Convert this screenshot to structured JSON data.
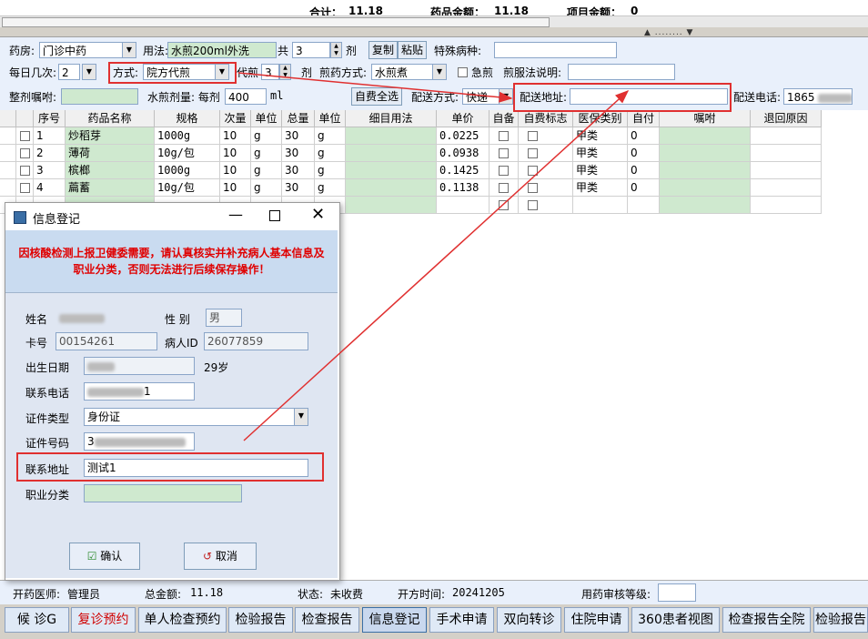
{
  "summary": {
    "total_label": "合计：",
    "total_value": "11.18",
    "drug_label": "药品金额：",
    "drug_value": "11.18",
    "item_label": "项目金额：",
    "item_value": "0"
  },
  "form": {
    "pharmacy_label": "药房:",
    "pharmacy_value": "门诊中药",
    "usage_label": "用法:",
    "usage_value": "水煎200ml外洗",
    "total_label": "共",
    "total_value": "3",
    "dose_unit": "剂",
    "copy_btn": "复制",
    "paste_btn": "粘贴",
    "special_label": "特殊病种:",
    "freq_label": "每日几次:",
    "freq_value": "2",
    "method_label": "方式:",
    "method_value": "院方代煎",
    "decoct_label": "代煎",
    "decoct_value": "3",
    "decoct_unit": "剂",
    "decoct_method_label": "煎药方式:",
    "decoct_method_value": "水煎煮",
    "urgent_label": "急煎",
    "pre_label": "煎服法说明:",
    "whole_label": "整剂嘱咐:",
    "water_label": "水煎剂量: 每剂",
    "water_value": "400",
    "water_unit": "ml",
    "selfpay_btn": "自费全选",
    "delivery_label": "配送方式:",
    "delivery_value": "快递",
    "address_label": "配送地址:",
    "address_value": "",
    "phone_label": "配送电话:",
    "phone_value": "1865"
  },
  "grid": {
    "headers": [
      "序号",
      "药品名称",
      "规格",
      "次量",
      "单位",
      "总量",
      "单位",
      "细目用法",
      "单价",
      "自备",
      "自费标志",
      "医保类别",
      "自付",
      "嘱咐",
      "退回原因"
    ],
    "rows": [
      {
        "no": "1",
        "name": "炒稻芽",
        "spec": "1000g",
        "qty": "10",
        "unit": "g",
        "total": "30",
        "tunit": "g",
        "price": "0.0225",
        "class": "甲类",
        "pay": "0"
      },
      {
        "no": "2",
        "name": "薄荷",
        "spec": "10g/包",
        "qty": "10",
        "unit": "g",
        "total": "30",
        "tunit": "g",
        "price": "0.0938",
        "class": "甲类",
        "pay": "0"
      },
      {
        "no": "3",
        "name": "槟榔",
        "spec": "1000g",
        "qty": "10",
        "unit": "g",
        "total": "30",
        "tunit": "g",
        "price": "0.1425",
        "class": "甲类",
        "pay": "0"
      },
      {
        "no": "4",
        "name": "萹蓄",
        "spec": "10g/包",
        "qty": "10",
        "unit": "g",
        "total": "30",
        "tunit": "g",
        "price": "0.1138",
        "class": "甲类",
        "pay": "0"
      }
    ]
  },
  "dialog": {
    "title": "信息登记",
    "warning": "因核酸检测上报卫健委需要，请认真核实并补充病人基本信息及职业分类，否则无法进行后续保存操作！",
    "name_label": "姓名",
    "gender_label": "性 别",
    "gender_value": "男",
    "card_label": "卡号",
    "card_value": "00154261",
    "pid_label": "病人ID",
    "pid_value": "26077859",
    "birth_label": "出生日期",
    "age_value": "29岁",
    "phone_label": "联系电话",
    "phone_tail": "1",
    "idtype_label": "证件类型",
    "idtype_value": "身份证",
    "idno_label": "证件号码",
    "idno_head": "3",
    "addr_label": "联系地址",
    "addr_value": "测试1",
    "job_label": "职业分类",
    "ok_btn": "确认",
    "cancel_btn": "取消"
  },
  "status": {
    "doctor_label": "开药医师:",
    "doctor_value": "管理员",
    "total_label": "总金额:",
    "total_value": "11.18",
    "state_label": "状态:",
    "state_value": "未收费",
    "time_label": "开方时间:",
    "time_value": "20241205",
    "audit_label": "用药审核等级:"
  },
  "toolbar": [
    "候 诊G",
    "复诊预约",
    "单人检查预约",
    "检验报告",
    "检查报告",
    "信息登记",
    "手术申请",
    "双向转诊",
    "住院申请",
    "360患者视图",
    "检查报告全院",
    "检验报告"
  ],
  "colors": {
    "annotation_red": "#e03030",
    "warning_red": "#e00000",
    "grid_green": "#cfe9cf"
  }
}
